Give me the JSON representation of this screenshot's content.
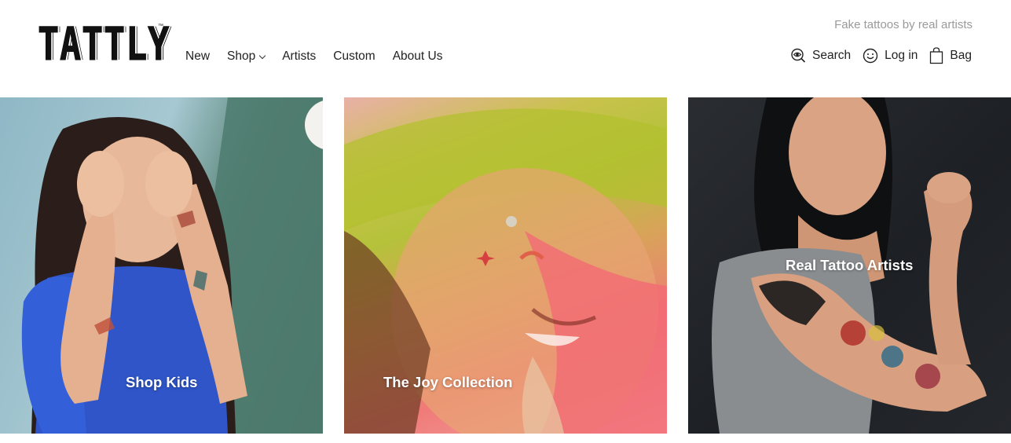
{
  "brand": {
    "logo_text": "TATTLY",
    "tm": "™"
  },
  "tagline": "Fake tattoos by real artists",
  "main_nav": [
    {
      "label": "New"
    },
    {
      "label": "Shop",
      "has_dropdown": true
    },
    {
      "label": "Artists"
    },
    {
      "label": "Custom"
    },
    {
      "label": "About Us"
    }
  ],
  "utility_nav": {
    "search": {
      "label": "Search",
      "icon": "search-eye-icon"
    },
    "login": {
      "label": "Log in",
      "icon": "smiley-icon"
    },
    "bag": {
      "label": "Bag",
      "icon": "bag-icon"
    }
  },
  "tiles": [
    {
      "label": "Shop Kids"
    },
    {
      "label": "The Joy Collection"
    },
    {
      "label": "Real Tattoo Artists"
    }
  ],
  "colors": {
    "text": "#222222",
    "tagline": "#9a9a9a",
    "tile_label": "#ffffff"
  }
}
